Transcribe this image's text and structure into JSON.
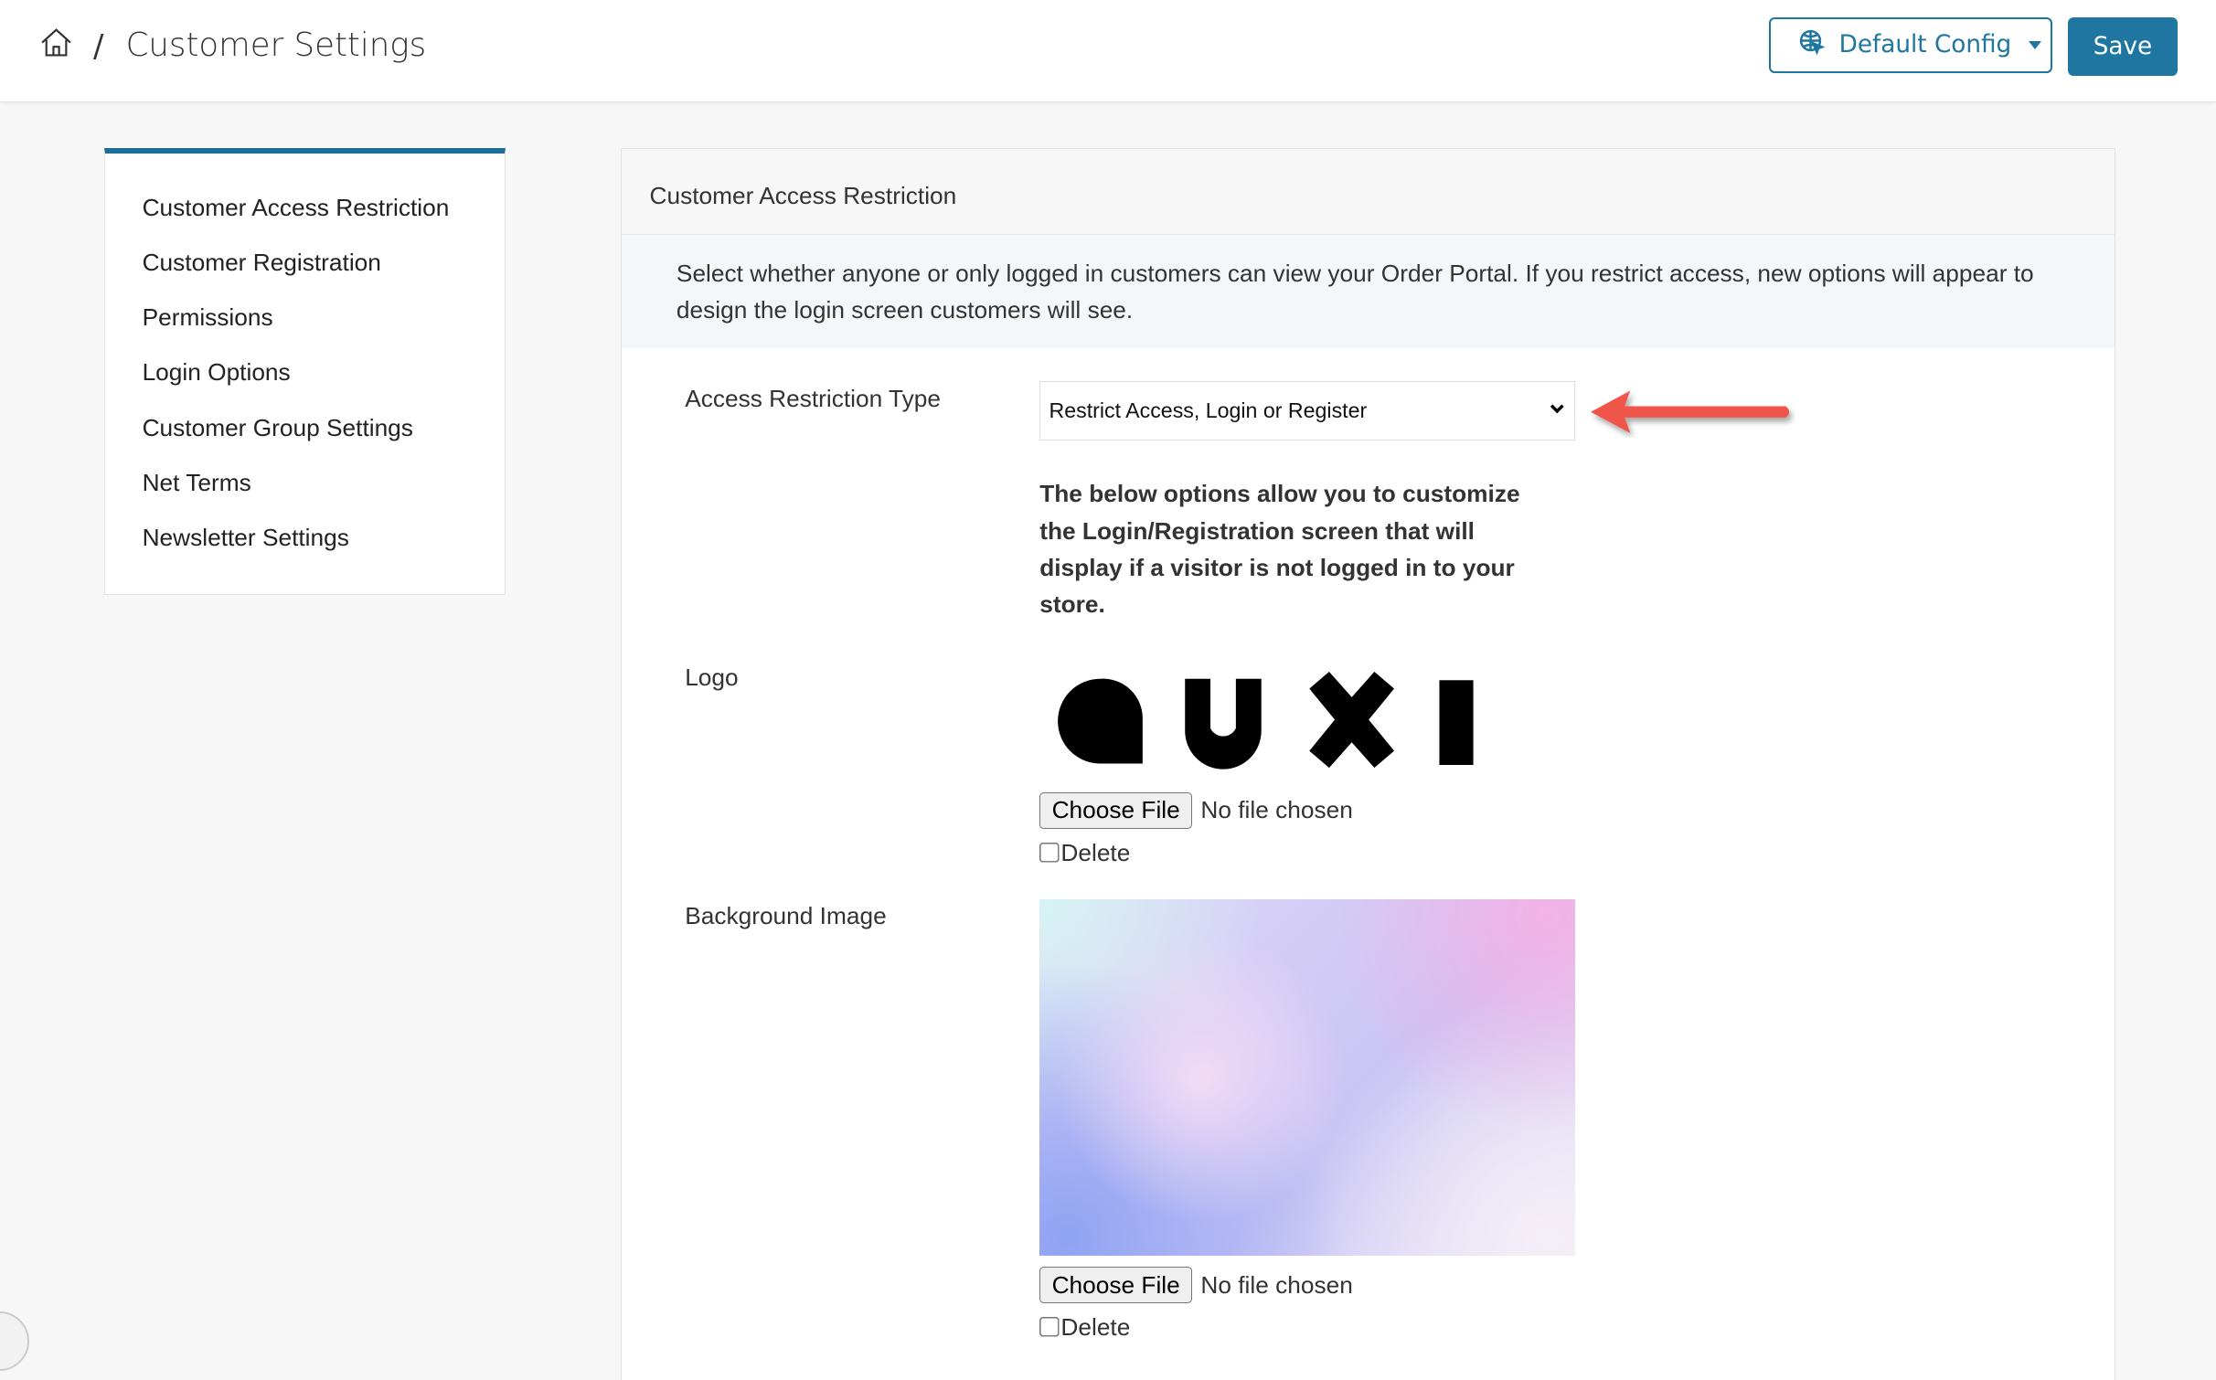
{
  "header": {
    "breadcrumb_sep": "/",
    "title": "Customer Settings",
    "config_label": "Default Config",
    "save_label": "Save",
    "accent": "#1f76a0"
  },
  "sidebar": {
    "items": [
      {
        "label": "Customer Access Restriction"
      },
      {
        "label": "Customer Registration"
      },
      {
        "label": "Permissions"
      },
      {
        "label": "Login Options"
      },
      {
        "label": "Customer Group Settings"
      },
      {
        "label": "Net Terms"
      },
      {
        "label": "Newsletter Settings"
      }
    ]
  },
  "panel": {
    "title": "Customer Access Restriction",
    "info": "Select whether anyone or only logged in customers can view your Order Portal. If you restrict access, new options will appear to design the login screen customers will see.",
    "access_label": "Access Restriction Type",
    "access_value": "Restrict Access, Login or Register",
    "note": "The below options allow you to customize the Login/Registration screen that will display if a visitor is not logged in to your store.",
    "logo_label": "Logo",
    "logo_text": "auxi",
    "bg_label": "Background Image",
    "choose_file": "Choose File",
    "no_file": "No file chosen",
    "delete_label": "Delete"
  }
}
